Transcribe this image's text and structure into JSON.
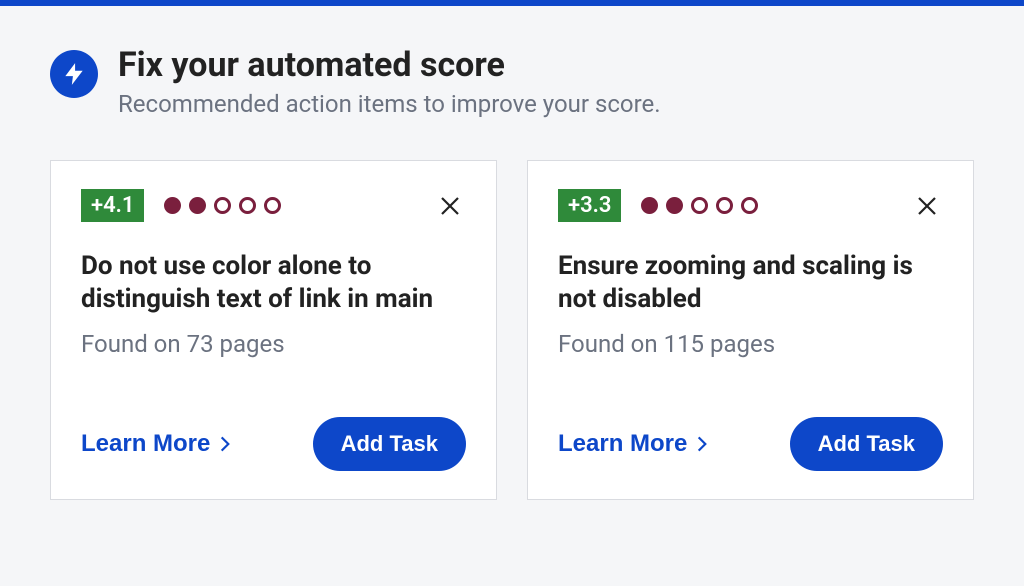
{
  "header": {
    "title": "Fix your automated score",
    "subtitle": "Recommended action items to improve your score."
  },
  "cards": [
    {
      "badge": "+4.1",
      "severity_filled": 2,
      "severity_total": 5,
      "title": "Do not use color alone to distinguish text of link in main",
      "subtitle": "Found on 73 pages",
      "learn_more_label": "Learn More",
      "add_task_label": "Add Task"
    },
    {
      "badge": "+3.3",
      "severity_filled": 2,
      "severity_total": 5,
      "title": "Ensure zooming and scaling is not disabled",
      "subtitle": "Found on 115 pages",
      "learn_more_label": "Learn More",
      "add_task_label": "Add Task"
    }
  ]
}
